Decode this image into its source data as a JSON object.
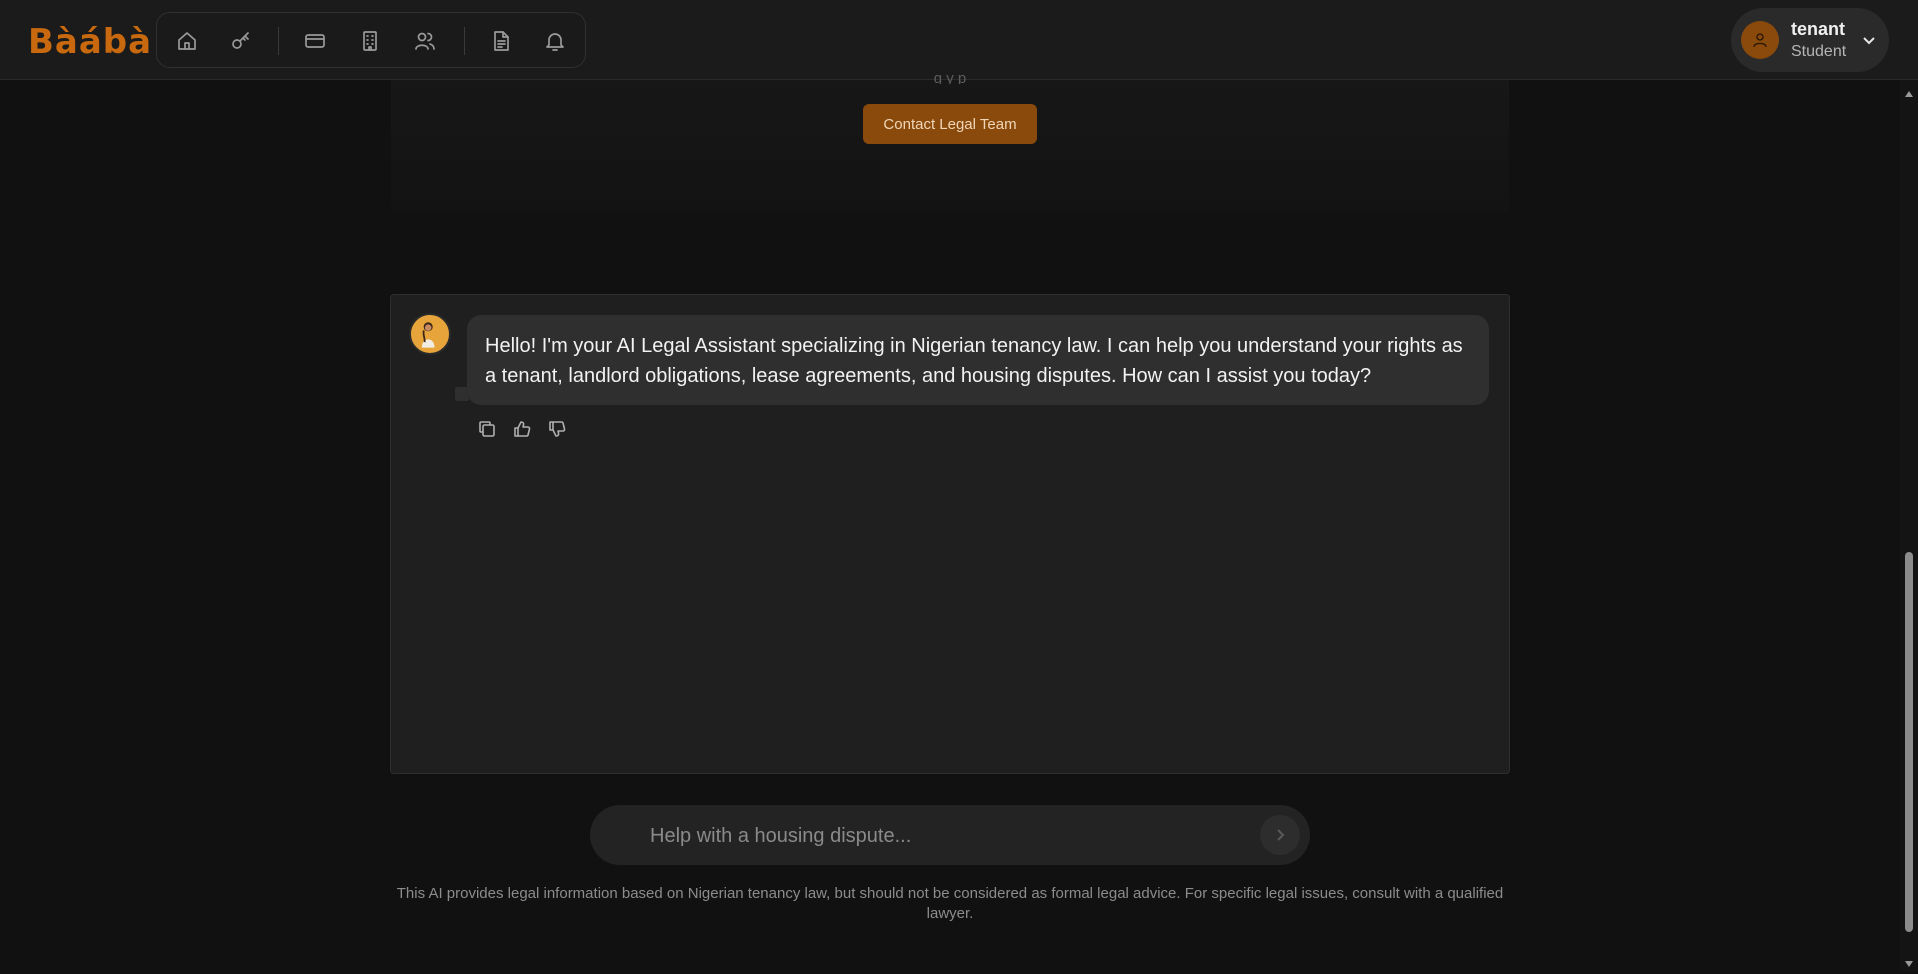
{
  "app": {
    "logo_text": "Bàábà",
    "accent_color": "#c8690f"
  },
  "nav": {
    "icons": [
      "home-icon",
      "key-icon",
      "credit-card-icon",
      "building-icon",
      "users-icon",
      "document-icon",
      "bell-icon"
    ]
  },
  "user": {
    "name": "tenant",
    "role": "Student"
  },
  "upper": {
    "cut_text": "g  y  p",
    "contact_button": "Contact Legal Team"
  },
  "chat": {
    "assistant_message": "Hello! I'm your AI Legal Assistant specializing in Nigerian tenancy law. I can help you understand your rights as a tenant, landlord obligations, lease agreements, and housing disputes. How can I assist you today?",
    "actions": [
      "copy-icon",
      "thumbs-up-icon",
      "thumbs-down-icon"
    ]
  },
  "input": {
    "placeholder": "Help with a housing dispute...",
    "value": ""
  },
  "disclaimer": "This AI provides legal information based on Nigerian tenancy law, but should not be considered as formal legal advice. For specific legal issues, consult with a qualified lawyer."
}
